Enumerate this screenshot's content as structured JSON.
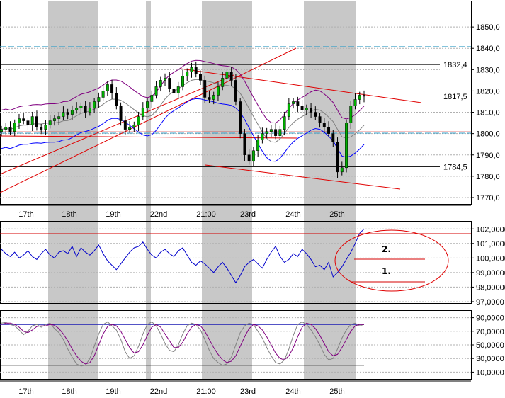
{
  "chart_data": {
    "type": "candlestick",
    "panes": [
      {
        "name": "price",
        "ylim": [
          1767,
          1862
        ],
        "y_ticks": [
          "1850,0",
          "1840,0",
          "1830,0",
          "1820,0",
          "1810,0",
          "1800,0",
          "1790,0",
          "1780,0",
          "1770,0"
        ],
        "y_tick_values": [
          1850,
          1840,
          1830,
          1820,
          1810,
          1800,
          1790,
          1780,
          1770
        ],
        "price_labels": [
          {
            "text": "1832,4",
            "value": 1832.4
          },
          {
            "text": "1817,5",
            "value": 1817.5
          },
          {
            "text": "1784,5",
            "value": 1784.5
          }
        ],
        "horizontal_lines": [
          {
            "value": 1832.4,
            "color": "#000000",
            "style": "solid"
          },
          {
            "value": 1784.5,
            "color": "#000000",
            "style": "solid"
          },
          {
            "value": 1840.8,
            "color": "#3aa0c8",
            "style": "dashed"
          },
          {
            "value": 1800.2,
            "color": "#3aa0c8",
            "style": "dashed"
          },
          {
            "value": 1800.8,
            "color": "#d40000",
            "style": "solid"
          },
          {
            "value": 1811.0,
            "color": "#d40000",
            "style": "dotted"
          }
        ],
        "close_series": [
          1802,
          1803,
          1801,
          1805,
          1807,
          1806,
          1804,
          1808,
          1803,
          1802,
          1804,
          1806,
          1807,
          1808,
          1810,
          1809,
          1811,
          1812,
          1813,
          1810,
          1812,
          1815,
          1817,
          1820,
          1823,
          1819,
          1813,
          1806,
          1802,
          1803,
          1804,
          1808,
          1812,
          1815,
          1818,
          1822,
          1825,
          1826,
          1821,
          1819,
          1822,
          1827,
          1829,
          1831,
          1828,
          1825,
          1817,
          1816,
          1818,
          1822,
          1826,
          1829,
          1825,
          1815,
          1800,
          1790,
          1787,
          1792,
          1797,
          1800,
          1801,
          1802,
          1799,
          1802,
          1808,
          1814,
          1815,
          1813,
          1811,
          1812,
          1810,
          1808,
          1805,
          1803,
          1800,
          1796,
          1782,
          1784,
          1805,
          1813,
          1816,
          1818,
          1817.5
        ]
      },
      {
        "name": "indicator",
        "ylim": [
          96.9,
          102.5
        ],
        "y_ticks": [
          "102,0000",
          "101,0000",
          "100,0000",
          "99,00000",
          "98,00000",
          "97,0000"
        ],
        "y_tick_values": [
          102,
          101,
          100,
          99,
          98,
          97
        ],
        "values": [
          100.6,
          100.3,
          100.1,
          100.4,
          100.0,
          100.2,
          100.5,
          100.1,
          99.9,
          100.3,
          100.6,
          100.2,
          100.0,
          100.4,
          100.5,
          100.3,
          100.8,
          100.1,
          100.7,
          100.4,
          100.2,
          100.5,
          100.9,
          100.3,
          99.8,
          99.5,
          99.2,
          99.6,
          100.0,
          100.4,
          100.7,
          100.8,
          101.1,
          100.6,
          100.2,
          100.0,
          100.4,
          100.6,
          100.3,
          100.1,
          100.5,
          100.7,
          100.2,
          99.7,
          99.5,
          99.8,
          99.6,
          99.3,
          99.0,
          99.4,
          99.7,
          99.3,
          98.8,
          98.3,
          98.8,
          99.4,
          99.7,
          99.9,
          99.6,
          99.3,
          99.9,
          100.4,
          100.8,
          100.1,
          99.7,
          99.9,
          100.3,
          100.1,
          100.6,
          100.3,
          99.9,
          99.4,
          99.5,
          99.2,
          99.7,
          98.7,
          99.0,
          99.4,
          99.9,
          100.4,
          101.0,
          101.7,
          102.0
        ]
      },
      {
        "name": "oscillator",
        "ylim": [
          0,
          100
        ],
        "y_ticks": [
          "90,0000",
          "70,0000",
          "50,0000",
          "30,0000",
          "10,0000"
        ],
        "y_tick_values": [
          90,
          70,
          50,
          30,
          10
        ],
        "horizontal_lines": [
          {
            "value": 80,
            "color": "#1c1cb4"
          },
          {
            "value": 20,
            "color": "#000000"
          }
        ],
        "fast": [
          82,
          83,
          80,
          78,
          72,
          65,
          70,
          78,
          80,
          76,
          80,
          82,
          74,
          68,
          58,
          44,
          32,
          22,
          19,
          20,
          30,
          48,
          66,
          80,
          84,
          78,
          72,
          58,
          40,
          30,
          34,
          48,
          66,
          80,
          84,
          78,
          66,
          52,
          42,
          40,
          50,
          66,
          78,
          82,
          80,
          72,
          58,
          42,
          30,
          24,
          20,
          22,
          32,
          50,
          68,
          78,
          82,
          80,
          70,
          60,
          46,
          34,
          24,
          22,
          28,
          44,
          64,
          80,
          84,
          80,
          72,
          62,
          50,
          36,
          28,
          30,
          44,
          60,
          72,
          80,
          82,
          78,
          80
        ],
        "slow": [
          80,
          82,
          82,
          80,
          76,
          70,
          68,
          72,
          77,
          78,
          78,
          80,
          79,
          74,
          66,
          56,
          44,
          34,
          26,
          22,
          24,
          34,
          50,
          66,
          77,
          80,
          78,
          70,
          58,
          46,
          38,
          40,
          50,
          64,
          76,
          80,
          76,
          66,
          56,
          46,
          46,
          54,
          66,
          76,
          80,
          78,
          70,
          58,
          46,
          36,
          28,
          24,
          26,
          34,
          48,
          62,
          74,
          80,
          78,
          72,
          62,
          50,
          38,
          30,
          28,
          34,
          46,
          62,
          76,
          82,
          80,
          74,
          64,
          52,
          40,
          34,
          36,
          46,
          58,
          70,
          78,
          80,
          80
        ]
      }
    ],
    "x_tick_labels": [
      "17th",
      "18th",
      "19th",
      "22nd",
      "21:00",
      "23rd",
      "24th",
      "25th"
    ],
    "annotations": [
      "2.",
      "1."
    ],
    "colors": {
      "up_candle": "#00b000",
      "down_candle": "#000000",
      "session_shade": "#c8c8c8",
      "trendline": "#e00000",
      "envelope_upper": "#800080",
      "envelope_lower": "#0000ff",
      "moving_average": "#808080",
      "indicator_line": "#0000cc",
      "osc_fast": "#808080",
      "osc_slow": "#800080"
    }
  }
}
